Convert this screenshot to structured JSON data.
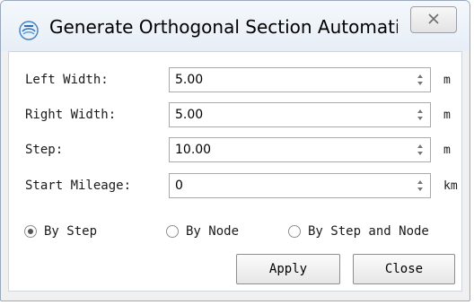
{
  "window": {
    "title": "Generate Orthogonal Section Automatic...",
    "icon": "app-logo-icon",
    "close_icon": "close-icon"
  },
  "form": {
    "left_width": {
      "label": "Left Width:",
      "value": "5.00",
      "unit": "m"
    },
    "right_width": {
      "label": "Right Width:",
      "value": "5.00",
      "unit": "m"
    },
    "step": {
      "label": "Step:",
      "value": "10.00",
      "unit": "m"
    },
    "start_mileage": {
      "label": "Start Mileage:",
      "value": "0",
      "unit": "km"
    }
  },
  "mode": {
    "options": [
      {
        "label": "By Step",
        "checked": true
      },
      {
        "label": "By Node",
        "checked": false
      },
      {
        "label": "By Step and Node",
        "checked": false
      }
    ]
  },
  "buttons": {
    "apply": "Apply",
    "close": "Close"
  },
  "colors": {
    "title_gradient_top": "#f4f8fc",
    "title_gradient_bottom": "#e7eef6",
    "window_border": "#9aa8bb"
  }
}
